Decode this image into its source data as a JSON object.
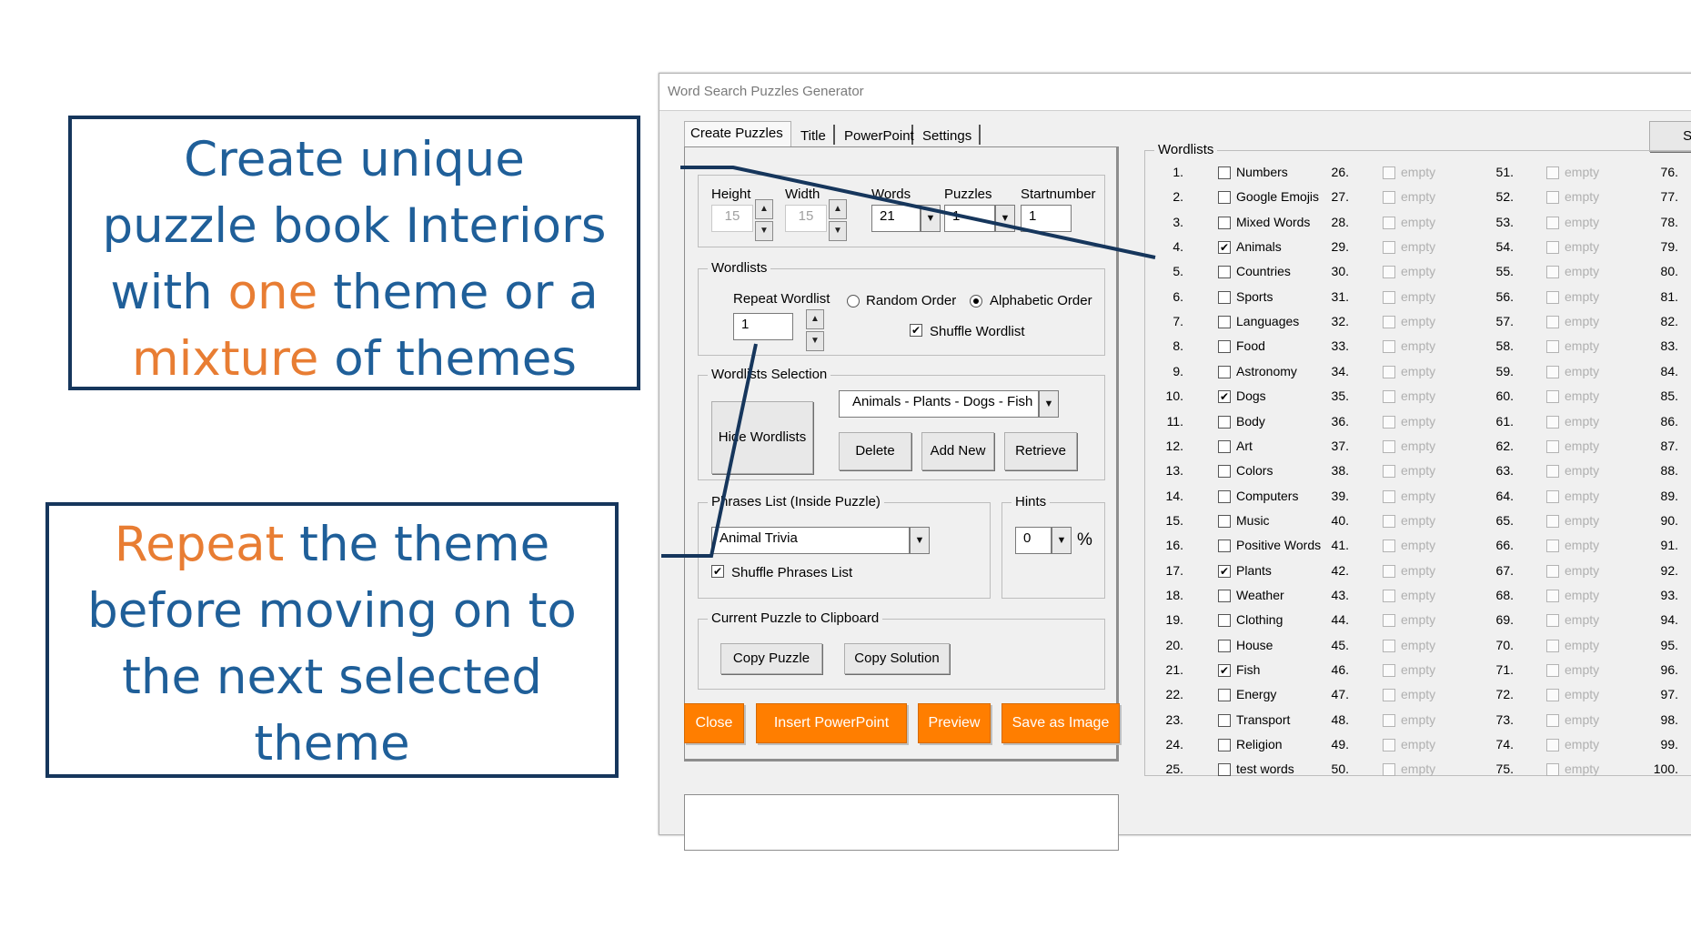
{
  "callouts": {
    "first": {
      "line1": "Create unique",
      "line2": "puzzle book Interiors",
      "line3_a": "with ",
      "line3_hl": "one",
      "line3_b": " theme or a",
      "line4_hl": "mixture",
      "line4_b": " of themes"
    },
    "second": {
      "hl": "Repeat",
      "line1_b": " the theme",
      "line2": "before moving on to",
      "line3": "the next selected",
      "line4": "theme"
    }
  },
  "window": {
    "title": "Word Search Puzzles Generator"
  },
  "tabs": [
    "Create Puzzles",
    "Title",
    "PowerPoint",
    "Settings"
  ],
  "select_all_label": "Select All",
  "size": {
    "height_label": "Height",
    "height_value": "15",
    "width_label": "Width",
    "width_value": "15",
    "words_label": "Words",
    "words_value": "21",
    "puzzles_label": "Puzzles",
    "puzzles_value": "1",
    "startnumber_label": "Startnumber",
    "startnumber_value": "1"
  },
  "wordlists_group": {
    "title": "Wordlists",
    "repeat_label": "Repeat Wordlist",
    "repeat_value": "1",
    "random_order": "Random Order",
    "alphabetic_order": "Alphabetic Order",
    "shuffle_wordlist": "Shuffle Wordlist"
  },
  "selection_group": {
    "title": "Wordlists Selection",
    "hide_button": "Hide Wordlists",
    "combo_value": "Animals - Plants - Dogs - Fish",
    "delete": "Delete",
    "add_new": "Add New",
    "retrieve": "Retrieve"
  },
  "phrases_group": {
    "title": "Phrases List (Inside Puzzle)",
    "value": "Animal Trivia",
    "shuffle": "Shuffle Phrases List"
  },
  "hints_group": {
    "title": "Hints",
    "value": "0",
    "unit": "%"
  },
  "clipboard_group": {
    "title": "Current Puzzle to Clipboard",
    "copy_puzzle": "Copy Puzzle",
    "copy_solution": "Copy Solution"
  },
  "action_buttons": {
    "close": "Close",
    "insert_powerpoint": "Insert PowerPoint",
    "preview": "Preview",
    "save_as_image": "Save as Image"
  },
  "wordlists": {
    "title": "Wordlists",
    "col1": [
      {
        "n": "1.",
        "name": "Numbers",
        "checked": false
      },
      {
        "n": "2.",
        "name": "Google Emojis",
        "checked": false
      },
      {
        "n": "3.",
        "name": "Mixed Words",
        "checked": false
      },
      {
        "n": "4.",
        "name": "Animals",
        "checked": true
      },
      {
        "n": "5.",
        "name": "Countries",
        "checked": false
      },
      {
        "n": "6.",
        "name": "Sports",
        "checked": false
      },
      {
        "n": "7.",
        "name": "Languages",
        "checked": false
      },
      {
        "n": "8.",
        "name": "Food",
        "checked": false
      },
      {
        "n": "9.",
        "name": "Astronomy",
        "checked": false
      },
      {
        "n": "10.",
        "name": "Dogs",
        "checked": true
      },
      {
        "n": "11.",
        "name": "Body",
        "checked": false
      },
      {
        "n": "12.",
        "name": "Art",
        "checked": false
      },
      {
        "n": "13.",
        "name": "Colors",
        "checked": false
      },
      {
        "n": "14.",
        "name": "Computers",
        "checked": false
      },
      {
        "n": "15.",
        "name": "Music",
        "checked": false
      },
      {
        "n": "16.",
        "name": "Positive Words",
        "checked": false
      },
      {
        "n": "17.",
        "name": "Plants",
        "checked": true
      },
      {
        "n": "18.",
        "name": "Weather",
        "checked": false
      },
      {
        "n": "19.",
        "name": "Clothing",
        "checked": false
      },
      {
        "n": "20.",
        "name": "House",
        "checked": false
      },
      {
        "n": "21.",
        "name": "Fish",
        "checked": true
      },
      {
        "n": "22.",
        "name": "Energy",
        "checked": false
      },
      {
        "n": "23.",
        "name": "Transport",
        "checked": false
      },
      {
        "n": "24.",
        "name": "Religion",
        "checked": false
      },
      {
        "n": "25.",
        "name": "test words",
        "checked": false
      }
    ],
    "empty_label": "empty",
    "col2_start": 26,
    "col3_start": 51,
    "col4_start": 76
  }
}
